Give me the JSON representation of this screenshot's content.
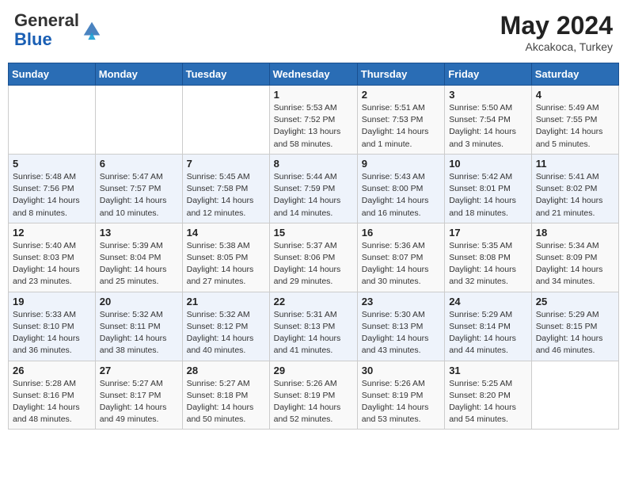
{
  "header": {
    "logo_line1": "General",
    "logo_line2": "Blue",
    "month_year": "May 2024",
    "location": "Akcakoca, Turkey"
  },
  "weekdays": [
    "Sunday",
    "Monday",
    "Tuesday",
    "Wednesday",
    "Thursday",
    "Friday",
    "Saturday"
  ],
  "weeks": [
    [
      {
        "day": "",
        "info": ""
      },
      {
        "day": "",
        "info": ""
      },
      {
        "day": "",
        "info": ""
      },
      {
        "day": "1",
        "info": "Sunrise: 5:53 AM\nSunset: 7:52 PM\nDaylight: 13 hours\nand 58 minutes."
      },
      {
        "day": "2",
        "info": "Sunrise: 5:51 AM\nSunset: 7:53 PM\nDaylight: 14 hours\nand 1 minute."
      },
      {
        "day": "3",
        "info": "Sunrise: 5:50 AM\nSunset: 7:54 PM\nDaylight: 14 hours\nand 3 minutes."
      },
      {
        "day": "4",
        "info": "Sunrise: 5:49 AM\nSunset: 7:55 PM\nDaylight: 14 hours\nand 5 minutes."
      }
    ],
    [
      {
        "day": "5",
        "info": "Sunrise: 5:48 AM\nSunset: 7:56 PM\nDaylight: 14 hours\nand 8 minutes."
      },
      {
        "day": "6",
        "info": "Sunrise: 5:47 AM\nSunset: 7:57 PM\nDaylight: 14 hours\nand 10 minutes."
      },
      {
        "day": "7",
        "info": "Sunrise: 5:45 AM\nSunset: 7:58 PM\nDaylight: 14 hours\nand 12 minutes."
      },
      {
        "day": "8",
        "info": "Sunrise: 5:44 AM\nSunset: 7:59 PM\nDaylight: 14 hours\nand 14 minutes."
      },
      {
        "day": "9",
        "info": "Sunrise: 5:43 AM\nSunset: 8:00 PM\nDaylight: 14 hours\nand 16 minutes."
      },
      {
        "day": "10",
        "info": "Sunrise: 5:42 AM\nSunset: 8:01 PM\nDaylight: 14 hours\nand 18 minutes."
      },
      {
        "day": "11",
        "info": "Sunrise: 5:41 AM\nSunset: 8:02 PM\nDaylight: 14 hours\nand 21 minutes."
      }
    ],
    [
      {
        "day": "12",
        "info": "Sunrise: 5:40 AM\nSunset: 8:03 PM\nDaylight: 14 hours\nand 23 minutes."
      },
      {
        "day": "13",
        "info": "Sunrise: 5:39 AM\nSunset: 8:04 PM\nDaylight: 14 hours\nand 25 minutes."
      },
      {
        "day": "14",
        "info": "Sunrise: 5:38 AM\nSunset: 8:05 PM\nDaylight: 14 hours\nand 27 minutes."
      },
      {
        "day": "15",
        "info": "Sunrise: 5:37 AM\nSunset: 8:06 PM\nDaylight: 14 hours\nand 29 minutes."
      },
      {
        "day": "16",
        "info": "Sunrise: 5:36 AM\nSunset: 8:07 PM\nDaylight: 14 hours\nand 30 minutes."
      },
      {
        "day": "17",
        "info": "Sunrise: 5:35 AM\nSunset: 8:08 PM\nDaylight: 14 hours\nand 32 minutes."
      },
      {
        "day": "18",
        "info": "Sunrise: 5:34 AM\nSunset: 8:09 PM\nDaylight: 14 hours\nand 34 minutes."
      }
    ],
    [
      {
        "day": "19",
        "info": "Sunrise: 5:33 AM\nSunset: 8:10 PM\nDaylight: 14 hours\nand 36 minutes."
      },
      {
        "day": "20",
        "info": "Sunrise: 5:32 AM\nSunset: 8:11 PM\nDaylight: 14 hours\nand 38 minutes."
      },
      {
        "day": "21",
        "info": "Sunrise: 5:32 AM\nSunset: 8:12 PM\nDaylight: 14 hours\nand 40 minutes."
      },
      {
        "day": "22",
        "info": "Sunrise: 5:31 AM\nSunset: 8:13 PM\nDaylight: 14 hours\nand 41 minutes."
      },
      {
        "day": "23",
        "info": "Sunrise: 5:30 AM\nSunset: 8:13 PM\nDaylight: 14 hours\nand 43 minutes."
      },
      {
        "day": "24",
        "info": "Sunrise: 5:29 AM\nSunset: 8:14 PM\nDaylight: 14 hours\nand 44 minutes."
      },
      {
        "day": "25",
        "info": "Sunrise: 5:29 AM\nSunset: 8:15 PM\nDaylight: 14 hours\nand 46 minutes."
      }
    ],
    [
      {
        "day": "26",
        "info": "Sunrise: 5:28 AM\nSunset: 8:16 PM\nDaylight: 14 hours\nand 48 minutes."
      },
      {
        "day": "27",
        "info": "Sunrise: 5:27 AM\nSunset: 8:17 PM\nDaylight: 14 hours\nand 49 minutes."
      },
      {
        "day": "28",
        "info": "Sunrise: 5:27 AM\nSunset: 8:18 PM\nDaylight: 14 hours\nand 50 minutes."
      },
      {
        "day": "29",
        "info": "Sunrise: 5:26 AM\nSunset: 8:19 PM\nDaylight: 14 hours\nand 52 minutes."
      },
      {
        "day": "30",
        "info": "Sunrise: 5:26 AM\nSunset: 8:19 PM\nDaylight: 14 hours\nand 53 minutes."
      },
      {
        "day": "31",
        "info": "Sunrise: 5:25 AM\nSunset: 8:20 PM\nDaylight: 14 hours\nand 54 minutes."
      },
      {
        "day": "",
        "info": ""
      }
    ]
  ]
}
